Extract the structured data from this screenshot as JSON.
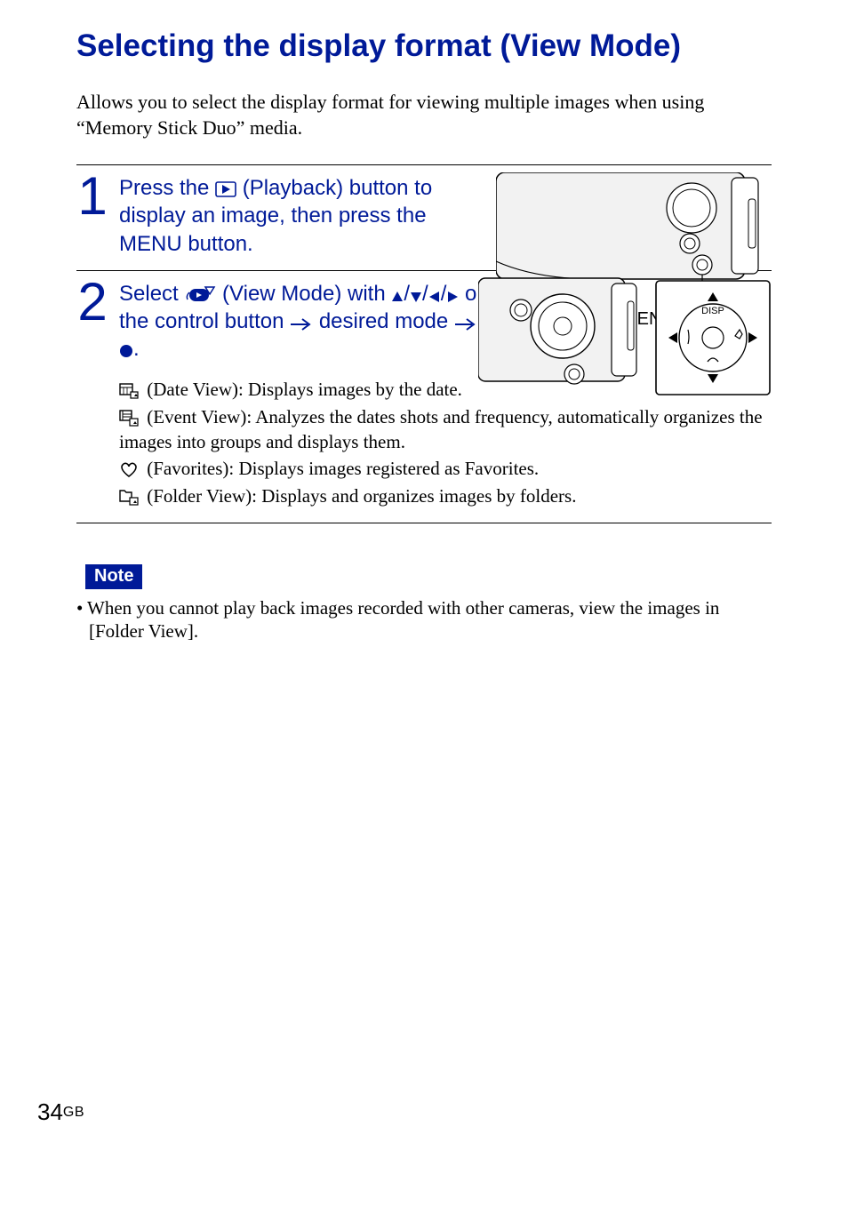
{
  "title": "Selecting the display format (View Mode)",
  "intro": "Allows you to select the display format for viewing multiple images when using “Memory Stick Duo” media.",
  "step1": {
    "num": "1",
    "pre": "Press the ",
    "mid": " (Playback) button to display an image, then press the MENU button.",
    "label": "MENU button"
  },
  "step2": {
    "num": "2",
    "a": "Select ",
    "b": " (View Mode) with ",
    "c": "/",
    "d": "/",
    "e": "/",
    "f": " on the control button ",
    "g": " desired mode ",
    "h": ".",
    "disp": "DISP"
  },
  "modes": {
    "date": " (Date View): Displays images by the date.",
    "event": " (Event View): Analyzes the dates shots and frequency, automatically organizes the images into groups and displays them.",
    "fav": " (Favorites): Displays images registered as Favorites.",
    "folder": " (Folder View): Displays and organizes images by folders."
  },
  "note": {
    "label": "Note",
    "item": "When you cannot play back images recorded with other cameras, view the images in [Folder View]."
  },
  "page": {
    "num": "34",
    "suffix": "GB"
  }
}
